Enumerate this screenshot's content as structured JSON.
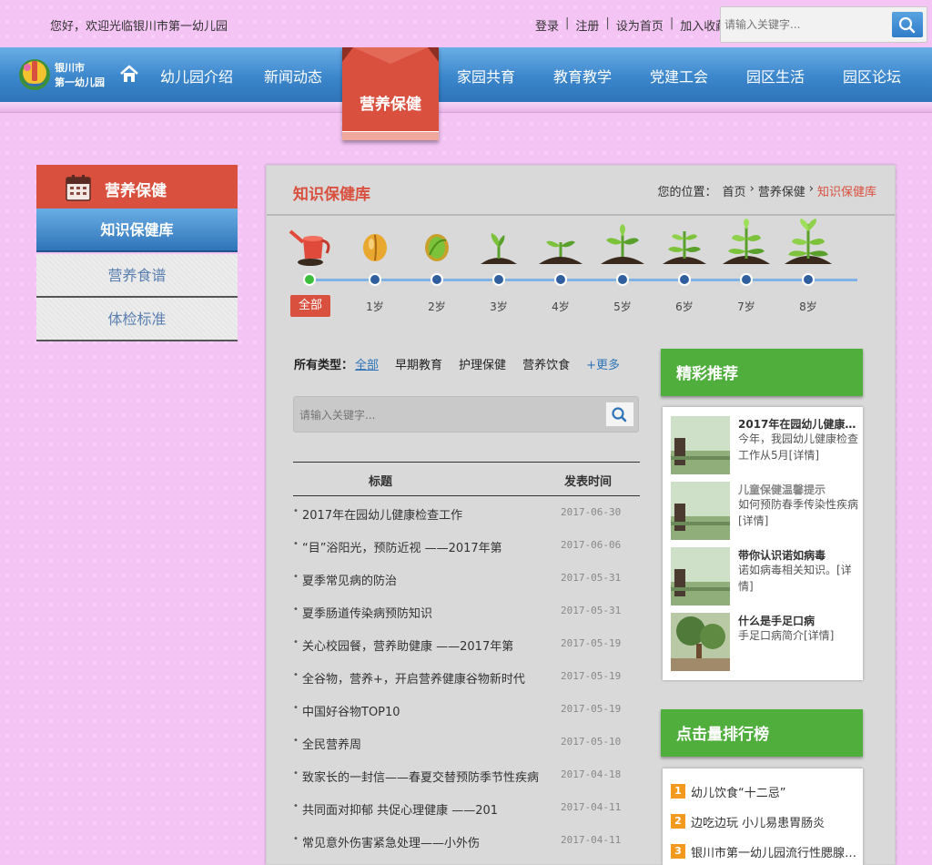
{
  "top": {
    "welcome": "您好，欢迎光临银川市第一幼儿园",
    "links": [
      "登录",
      "注册",
      "设为首页",
      "加入收藏"
    ],
    "search_placeholder": "请输入关键字..."
  },
  "logo": {
    "line1": "银川市",
    "line2": "第一幼儿园"
  },
  "nav": {
    "items_left": [
      "幼儿园介绍",
      "新闻动态"
    ],
    "active": "营养保健",
    "items_right": [
      "家园共育",
      "教育教学",
      "党建工会",
      "园区生活",
      "园区论坛"
    ]
  },
  "sidebar": {
    "title": "营养保健",
    "items": [
      "知识保健库",
      "营养食谱",
      "体检标准"
    ]
  },
  "main": {
    "title": "知识保健库",
    "breadcrumb": {
      "label": "您的位置：",
      "home": "首页",
      "section": "营养保健",
      "current": "知识保健库"
    }
  },
  "timeline": {
    "all": "全部",
    "ages": [
      "1岁",
      "2岁",
      "3岁",
      "4岁",
      "5岁",
      "6岁",
      "7岁",
      "8岁"
    ]
  },
  "filter": {
    "label": "所有类型：",
    "selected": "全部",
    "options": [
      "早期教育",
      "护理保健",
      "营养饮食"
    ],
    "more": "+更多"
  },
  "list_search_placeholder": "请输入关键字...",
  "table": {
    "col_title": "标题",
    "col_date": "发表时间",
    "rows": [
      {
        "title": "2017年在园幼儿健康检查工作",
        "date": "2017-06-30"
      },
      {
        "title": "“目”浴阳光，预防近视 ——2017年第",
        "date": "2017-06-06"
      },
      {
        "title": "夏季常见病的防治",
        "date": "2017-05-31"
      },
      {
        "title": "夏季肠道传染病预防知识",
        "date": "2017-05-31"
      },
      {
        "title": "关心校园餐，营养助健康 ——2017年第",
        "date": "2017-05-19"
      },
      {
        "title": "全谷物，营养+，开启营养健康谷物新时代",
        "date": "2017-05-19"
      },
      {
        "title": "中国好谷物TOP10",
        "date": "2017-05-19"
      },
      {
        "title": "全民营养周",
        "date": "2017-05-10"
      },
      {
        "title": "致家长的一封信——春夏交替预防季节性疾病",
        "date": "2017-04-18"
      },
      {
        "title": "共同面对抑郁 共促心理健康 ——201",
        "date": "2017-04-11"
      },
      {
        "title": "常见意外伤害紧急处理——小外伤",
        "date": "2017-04-11"
      }
    ]
  },
  "recommend": {
    "title": "精彩推荐",
    "items": [
      {
        "title": "2017年在园幼儿健康…",
        "desc": "今年，我园幼儿健康检查工作从5月[详情]"
      },
      {
        "title": "儿童保健温馨提示",
        "desc": "如何预防春季传染性疾病[详情]"
      },
      {
        "title": "带你认识诺如病毒",
        "desc": "诺如病毒相关知识。[详情]"
      },
      {
        "title": "什么是手足口病",
        "desc": "手足口病简介[详情]"
      }
    ]
  },
  "ranking": {
    "title": "点击量排行榜",
    "items": [
      {
        "num": "1",
        "title": "幼儿饮食“十二忌”"
      },
      {
        "num": "2",
        "title": "边吃边玩 小儿易患胃肠炎"
      },
      {
        "num": "3",
        "title": "银川市第一幼儿园流行性腮腺…"
      }
    ]
  }
}
